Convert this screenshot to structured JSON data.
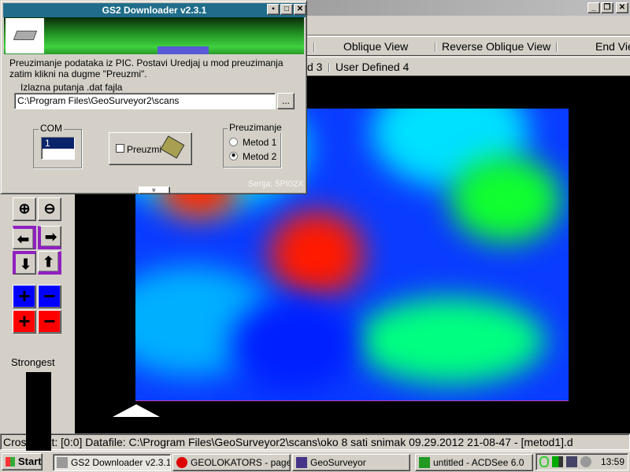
{
  "dialog": {
    "title": "GS2 Downloader v2.3.1",
    "instructions": "Preuzimanje podataka iz PIC. Postavi Uredjaj u mod preuzimanja zatim klikni na dugme \"Preuzmi\".",
    "path_label": "Izlazna putanja .dat fajla",
    "path_value": "C:\\Program Files\\GeoSurveyor2\\scans",
    "browse_label": "...",
    "com_label": "COM",
    "com_options": [
      "1"
    ],
    "download_label": "Preuzmi",
    "method_group_label": "Preuzimanje",
    "methods": [
      {
        "label": "Metod 1",
        "checked": false
      },
      {
        "label": "Metod 2",
        "checked": true
      }
    ],
    "serial": "Serija: 5PI02X",
    "expand": "»"
  },
  "app": {
    "window_buttons": [
      "_",
      "❐",
      "✕"
    ],
    "toolbar1": [
      "Oblique View",
      "Reverse Oblique View",
      "End View"
    ],
    "toolbar2": [
      "d 3",
      "User Defined 4"
    ],
    "strongest_label": "Strongest",
    "status": "Cros      Point: [0:0]   Datafile: C:\\Program Files\\GeoSurveyor2\\scans\\oko 8 sati snimak  09.29.2012 21-08-47 - [metod1].d"
  },
  "taskbar": {
    "start": "Start",
    "tasks": [
      "GS2 Downloader v2.3.1",
      "GEOLOKATORS - page...",
      "GeoSurveyor",
      "untitled - ACDSee 6.0"
    ],
    "clock": "13:59"
  },
  "colors": {
    "title": "#1f6d8a",
    "heat_base": "#0a3cff"
  }
}
